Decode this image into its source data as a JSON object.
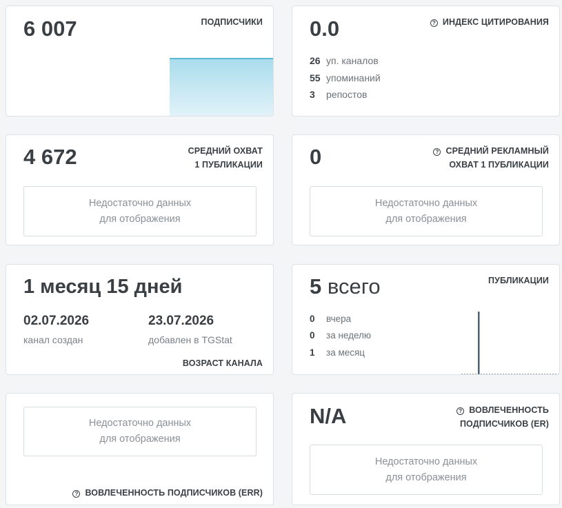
{
  "subscribers": {
    "value": "6 007",
    "caption": "ПОДПИСЧИКИ",
    "chart_color": "#5ab7d6"
  },
  "citation": {
    "value": "0.0",
    "caption": "ИНДЕКС ЦИТИРОВАНИЯ",
    "stats": [
      {
        "num": "26",
        "label": "уп. каналов"
      },
      {
        "num": "55",
        "label": "упоминаний"
      },
      {
        "num": "3",
        "label": "репостов"
      }
    ]
  },
  "avg_reach": {
    "value": "4 672",
    "caption_line1": "СРЕДНИЙ ОХВАТ",
    "caption_line2": "1 ПУБЛИКАЦИИ",
    "nodata_line1": "Недостаточно данных",
    "nodata_line2": "для отображения"
  },
  "ad_reach": {
    "value": "0",
    "caption_line1": "СРЕДНИЙ РЕКЛАМНЫЙ",
    "caption_line2": "ОХВАТ 1 ПУБЛИКАЦИИ",
    "nodata_line1": "Недостаточно данных",
    "nodata_line2": "для отображения"
  },
  "channel_age": {
    "value": "1 месяц 15 дней",
    "created_date": "02.07.2026",
    "created_label": "канал создан",
    "added_date": "23.07.2026",
    "added_label": "добавлен в TGStat",
    "caption": "ВОЗРАСТ КАНАЛА"
  },
  "publications": {
    "value_num": "5",
    "value_word": "всего",
    "caption": "ПУБЛИКАЦИИ",
    "stats": [
      {
        "num": "0",
        "label": "вчера"
      },
      {
        "num": "0",
        "label": "за неделю"
      },
      {
        "num": "1",
        "label": "за месяц"
      }
    ],
    "bar_color": "#4a6275"
  },
  "err": {
    "nodata_line1": "Недостаточно данных",
    "nodata_line2": "для отображения",
    "caption": "ВОВЛЕЧЕННОСТЬ ПОДПИСЧИКОВ (ERR)"
  },
  "er": {
    "value": "N/A",
    "caption_line1": "ВОВЛЕЧЕННОСТЬ",
    "caption_line2": "ПОДПИСЧИКОВ (ER)",
    "nodata_line1": "Недостаточно данных",
    "nodata_line2": "для отображения"
  },
  "icons": {
    "help": "question-circle-icon"
  }
}
